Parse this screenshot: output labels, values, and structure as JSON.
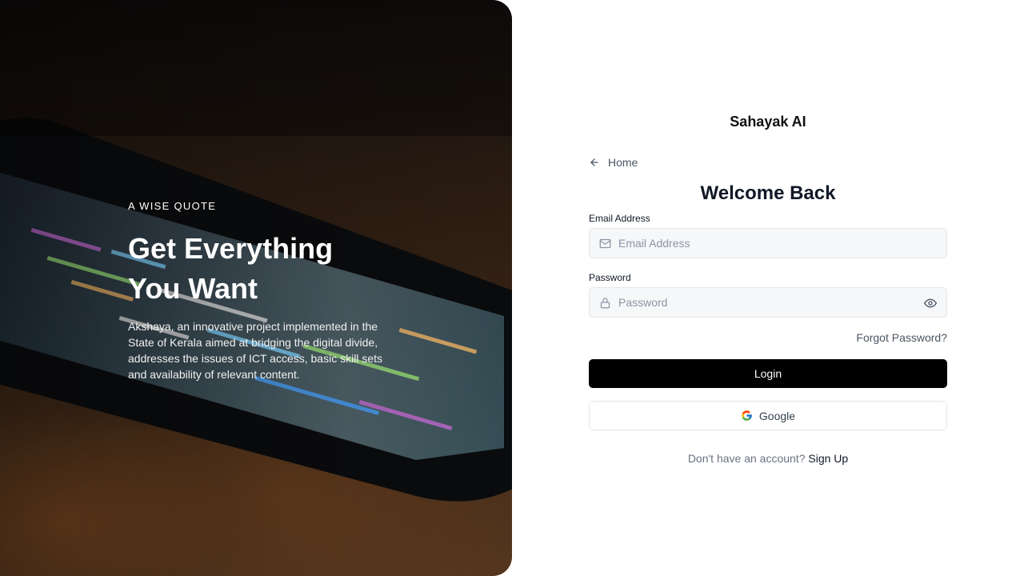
{
  "hero": {
    "eyebrow": "A WISE QUOTE",
    "title": "Get Everything You Want",
    "description": "Akshaya, an innovative project implemented in the State of Kerala aimed at bridging the digital divide, addresses the issues of ICT access, basic skill sets and availability of relevant content.",
    "background_image": "smartphone-with-code-on-wooden-table"
  },
  "brand": {
    "name": "Sahayak AI"
  },
  "nav": {
    "home_label": "Home",
    "home_icon": "arrow-left-icon"
  },
  "form": {
    "heading": "Welcome Back",
    "email": {
      "label": "Email Address",
      "placeholder": "Email Address",
      "value": "",
      "icon": "mail-icon"
    },
    "password": {
      "label": "Password",
      "placeholder": "Password",
      "value": "",
      "icon": "lock-icon",
      "toggle_icon": "eye-icon"
    },
    "forgot_label": "Forgot Password?",
    "login_label": "Login",
    "google_label": "Google",
    "signup_prompt": "Don't have an account?",
    "signup_label": "Sign Up"
  },
  "colors": {
    "primary_button": "#000000",
    "input_background": "#f6f7f9",
    "border": "#e5e7eb",
    "muted_text": "#6b7280"
  }
}
